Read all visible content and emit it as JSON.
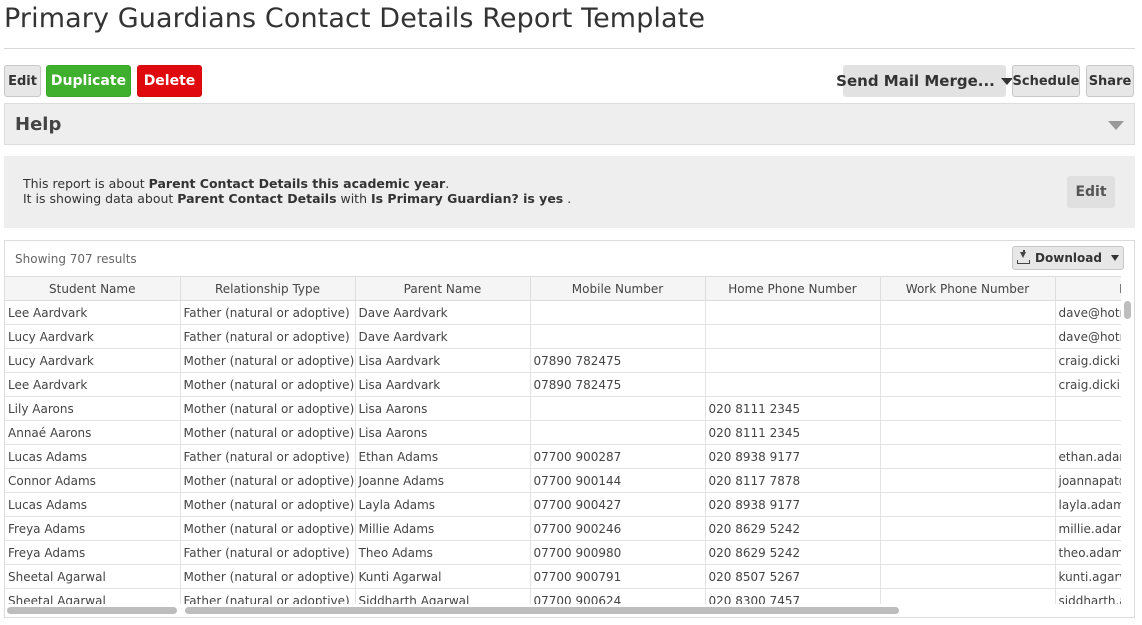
{
  "page": {
    "title": "Primary Guardians Contact Details Report Template"
  },
  "toolbar": {
    "edit_label": "Edit",
    "duplicate_label": "Duplicate",
    "delete_label": "Delete",
    "mail_merge_label": "Send Mail Merge...",
    "schedule_label": "Schedule",
    "share_label": "Share"
  },
  "help": {
    "label": "Help"
  },
  "info": {
    "line1_prefix": "This report is about ",
    "line1_bold": "Parent Contact Details this academic year",
    "line1_suffix": ".",
    "line2_prefix": "It is showing data about ",
    "line2_bold1": "Parent Contact Details",
    "line2_mid": " with ",
    "line2_bold2": "Is Primary Guardian? is yes",
    "line2_suffix": " .",
    "edit_label": "Edit"
  },
  "results": {
    "showing_text": "Showing 707 results",
    "download_label": "Download"
  },
  "table": {
    "columns": [
      "Student Name",
      "Relationship Type",
      "Parent Name",
      "Mobile Number",
      "Home Phone Number",
      "Work Phone Number",
      "Main Em"
    ],
    "rows": [
      [
        "Lee Aardvark",
        "Father (natural or adoptive)",
        "Dave Aardvark",
        "",
        "",
        "",
        "dave@hotr"
      ],
      [
        "Lucy Aardvark",
        "Father (natural or adoptive)",
        "Dave Aardvark",
        "",
        "",
        "",
        "dave@hotr"
      ],
      [
        "Lucy Aardvark",
        "Mother (natural or adoptive)",
        "Lisa Aardvark",
        "07890 782475",
        "",
        "",
        "craig.dickir"
      ],
      [
        "Lee Aardvark",
        "Mother (natural or adoptive)",
        "Lisa Aardvark",
        "07890 782475",
        "",
        "",
        "craig.dickir"
      ],
      [
        "Lily Aarons",
        "Mother (natural or adoptive)",
        "Lisa Aarons",
        "",
        "020 8111 2345",
        "",
        ""
      ],
      [
        "Annaé Aarons",
        "Mother (natural or adoptive)",
        "Lisa Aarons",
        "",
        "020 8111 2345",
        "",
        ""
      ],
      [
        "Lucas Adams",
        "Father (natural or adoptive)",
        "Ethan Adams",
        "07700 900287",
        "020 8938 9177",
        "",
        "ethan.adam"
      ],
      [
        "Connor Adams",
        "Mother (natural or adoptive)",
        "Joanne Adams",
        "07700 900144",
        "020 8117 7878",
        "",
        "joannapat@"
      ],
      [
        "Lucas Adams",
        "Mother (natural or adoptive)",
        "Layla Adams",
        "07700 900427",
        "020 8938 9177",
        "",
        "layla.adam"
      ],
      [
        "Freya Adams",
        "Mother (natural or adoptive)",
        "Millie Adams",
        "07700 900246",
        "020 8629 5242",
        "",
        "millie.adam"
      ],
      [
        "Freya Adams",
        "Father (natural or adoptive)",
        "Theo Adams",
        "07700 900980",
        "020 8629 5242",
        "",
        "theo.adams"
      ],
      [
        "Sheetal Agarwal",
        "Mother (natural or adoptive)",
        "Kunti Agarwal",
        "07700 900791",
        "020 8507 5267",
        "",
        "kunti.agarv"
      ],
      [
        "Sheetal Agarwal",
        "Father (natural or adoptive)",
        "Siddharth Agarwal",
        "07700 900624",
        "020 8300 7457",
        "",
        "siddharth.a"
      ]
    ]
  }
}
